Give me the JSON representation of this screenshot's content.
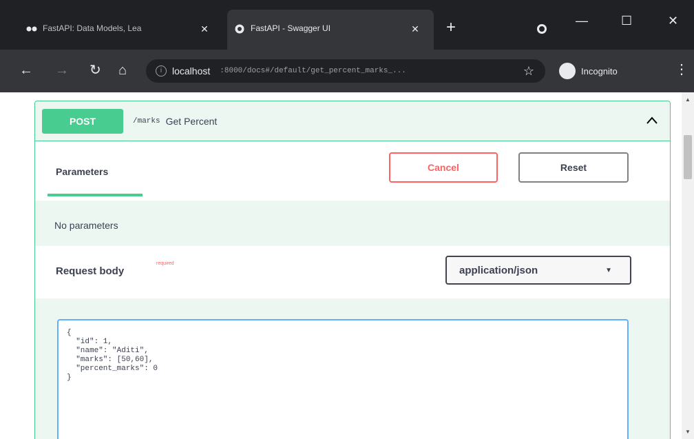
{
  "browser": {
    "tabs": [
      {
        "title": "FastAPI: Data Models, Lea",
        "icon": "fastapi-dots-icon",
        "close": "✕"
      },
      {
        "title": "FastAPI - Swagger UI",
        "icon": "swagger-icon",
        "close": "✕"
      }
    ],
    "new_tab": "+",
    "window_controls": {
      "minimize": "—",
      "maximize": "☐",
      "close": "✕"
    },
    "address": {
      "host": "localhost",
      "path": ":8000/docs#/default/get_percent_marks_..."
    },
    "profile_label": "Incognito"
  },
  "operation": {
    "method": "POST",
    "path": "/marks",
    "summary": "Get Percent",
    "parameters_tab": "Parameters",
    "cancel_label": "Cancel",
    "reset_label": "Reset",
    "no_parameters": "No parameters",
    "request_body_label": "Request body",
    "required_label": "required",
    "content_type": "application/json",
    "body_text": "{\n  \"id\": 1,\n  \"name\": \"Aditi\",\n  \"marks\": [50,60],\n  \"percent_marks\": 0\n}"
  },
  "colors": {
    "post_green": "#49cc90",
    "cancel_red": "#ff6060",
    "editor_blue": "#61affe",
    "chrome_dark": "#202124"
  }
}
